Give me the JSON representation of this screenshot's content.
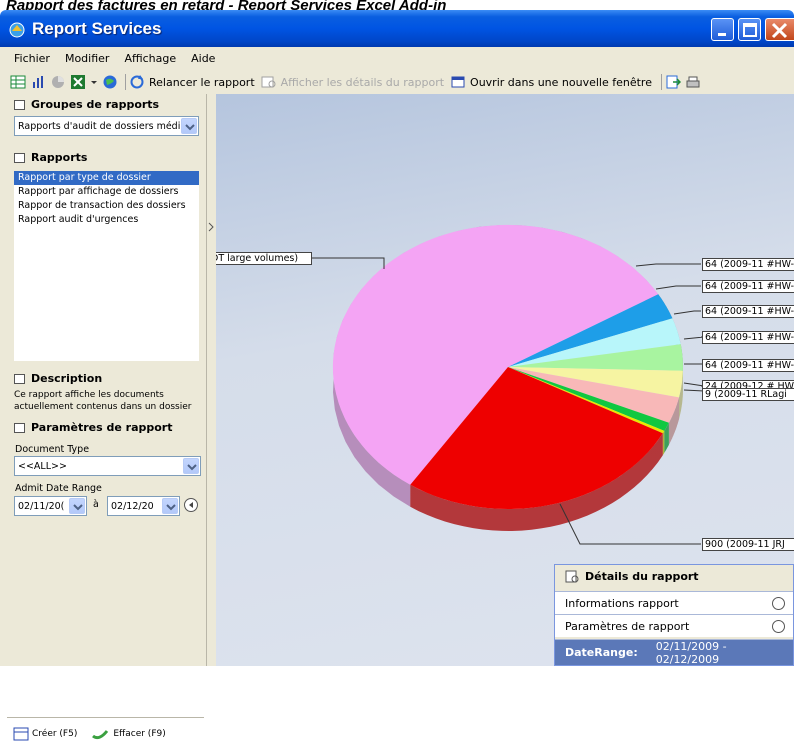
{
  "caption": "Rapport des factures en retard - Report Services Excel Add-in",
  "window": {
    "title": "Report Services"
  },
  "menu": [
    "Fichier",
    "Modifier",
    "Affichage",
    "Aide"
  ],
  "toolbar": {
    "rerun": "Relancer le rapport",
    "details": "Afficher les détails du rapport",
    "open_new": "Ouvrir dans une nouvelle fenêtre"
  },
  "left": {
    "groups_title": "Groupes de rapports",
    "groups_value": "Rapports d'audit de dossiers médi",
    "reports_title": "Rapports",
    "reports": [
      "Rapport par type de dossier",
      "Rapport par affichage de dossiers",
      "Rappor de transaction des dossiers",
      "Rapport audit d'urgences"
    ],
    "description_title": "Description",
    "description_text": "Ce rapport affiche les documents actuellement contenus dans un dossier",
    "params_title": "Paramètres de rapport",
    "doc_type_label": "Document Type",
    "doc_type_value": "<<ALL>>",
    "date_label": "Admit Date Range",
    "date_from": "02/11/20(",
    "date_sep": "à",
    "date_to": "02/12/20",
    "create_label": "Créer (F5)",
    "clear_label": "Effacer (F9)"
  },
  "chart_data": {
    "type": "pie",
    "colors": {
      "pink": "#f4a4f4",
      "red": "#ee0000",
      "blue": "#1e9ee8",
      "light_cyan": "#b8f6fa",
      "light_green": "#a8f4a0",
      "light_yellow": "#f6f4a2",
      "salmon": "#f8b8b8",
      "green": "#10c840",
      "yellow": "#e8e800"
    },
    "slices": [
      {
        "name": "pink",
        "value": 57.0
      },
      {
        "name": "blue",
        "value": 3.0
      },
      {
        "name": "light_cyan",
        "value": 3.0
      },
      {
        "name": "light_green",
        "value": 3.0
      },
      {
        "name": "light_yellow",
        "value": 3.0
      },
      {
        "name": "salmon",
        "value": 3.0
      },
      {
        "name": "green",
        "value": 1.0
      },
      {
        "name": "yellow",
        "value": 0.3
      },
      {
        "name": "red",
        "value": 26.7
      }
    ],
    "labels": [
      "DT large volumes)",
      "64 (2009-11 #HW-",
      "64 (2009-11 #HW-",
      "64 (2009-11 #HW-",
      "64 (2009-11 #HW-",
      "64 (2009-11 #HW-",
      "24 (2009-12 # HW",
      "9 (2009-11 RLagi",
      "900 (2009-11 JRJ"
    ]
  },
  "details_panel": {
    "title": "Détails du rapport",
    "info": "Informations rapport",
    "params": "Paramètres de rapport",
    "daterange_label": "DateRange:",
    "daterange_value": "02/11/2009 - 02/12/2009"
  }
}
